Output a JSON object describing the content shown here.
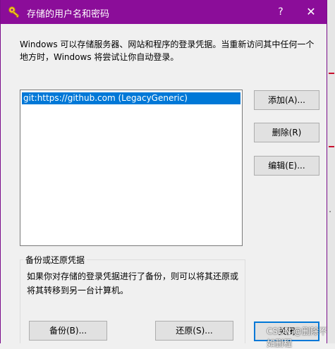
{
  "window": {
    "title": "存储的用户名和密码",
    "help_label": "?",
    "close_label": "✕"
  },
  "intro_text": "Windows 可以存储服务器、网站和程序的登录凭据。当重新访问其中任何一个地方时，Windows 将尝试让你自动登录。",
  "credentials": {
    "items": [
      {
        "label": "git:https://github.com (LegacyGeneric)",
        "selected": true
      }
    ]
  },
  "buttons": {
    "add": "添加(A)...",
    "delete": "删除(R)",
    "edit": "编辑(E)...",
    "backup": "备份(B)...",
    "restore": "还原(S)...",
    "close": "关闭"
  },
  "backup_group": {
    "title": "备份或还原凭据",
    "description": "如果你对存储的登录凭据进行了备份，则可以将其还原或将其转移到另一台计算机。"
  },
  "watermark": "CSDN @删除不如删程",
  "colors": {
    "titlebar": "#8b0d99",
    "selection": "#0078d7",
    "default_button_border": "#0078d7"
  },
  "icons": {
    "title": "key-icon"
  }
}
